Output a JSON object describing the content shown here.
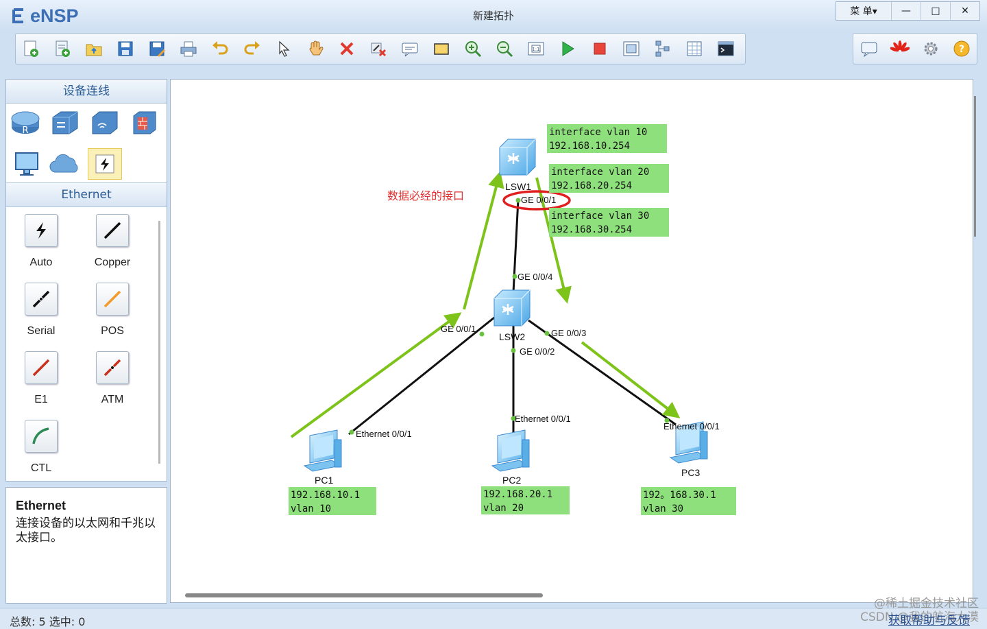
{
  "window": {
    "app_name": "eNSP",
    "title": "新建拓扑",
    "menu_label": "菜 单▾",
    "min_glyph": "—",
    "max_glyph": "□",
    "close_glyph": "✕"
  },
  "toolbar": {
    "icons": [
      "new-topology-icon",
      "new-example-icon",
      "open-icon",
      "save-icon",
      "save-as-icon",
      "print-icon",
      "undo-icon",
      "redo-icon",
      "select-icon",
      "pan-hand-icon",
      "delete-icon",
      "delete-link-icon",
      "text-label-icon",
      "rectangle-icon",
      "zoom-in-icon",
      "zoom-out-icon",
      "fit-to-window-icon",
      "start-device-icon",
      "stop-device-icon",
      "capture-icon",
      "topology-icon",
      "grid-icon",
      "cli-icon"
    ],
    "right_icons": [
      "chat-icon",
      "huawei-icon",
      "settings-icon",
      "help-icon"
    ]
  },
  "left_panel": {
    "devices_header": "设备连线",
    "devices": [
      "router-icon",
      "switch-icon",
      "wireless-icon",
      "firewall-icon",
      "pc-icon",
      "cloud-icon",
      "connection-icon"
    ],
    "ethernet_header": "Ethernet",
    "cables": [
      {
        "label": "Auto",
        "icon": "auto-cable-icon",
        "color": "#111111"
      },
      {
        "label": "Copper",
        "icon": "copper-cable-icon",
        "color": "#111111"
      },
      {
        "label": "Serial",
        "icon": "serial-cable-icon",
        "color": "#111111"
      },
      {
        "label": "POS",
        "icon": "pos-cable-icon",
        "color": "#f39a2b"
      },
      {
        "label": "E1",
        "icon": "e1-cable-icon",
        "color": "#c8321e"
      },
      {
        "label": "ATM",
        "icon": "atm-cable-icon",
        "color": "#c8321e"
      },
      {
        "label": "CTL",
        "icon": "ctl-cable-icon",
        "color": "#2e8b57"
      }
    ]
  },
  "info_panel": {
    "title": "Ethernet",
    "description": "连接设备的以太网和千兆以太接口。"
  },
  "topology": {
    "annotation": "数据必经的接口",
    "devices": {
      "lsw1": "LSW1",
      "lsw2": "LSW2",
      "pc1": "PC1",
      "pc2": "PC2",
      "pc3": "PC3"
    },
    "ports": {
      "lsw1_ge001": "GE 0/0/1",
      "lsw2_ge004": "GE 0/0/4",
      "lsw2_ge001": "GE 0/0/1",
      "lsw2_ge002": "GE 0/0/2",
      "lsw2_ge003": "GE 0/0/3",
      "pc1_eth": "Ethernet 0/0/1",
      "pc2_eth": "Ethernet 0/0/1",
      "pc3_eth": "Ethernet 0/0/1"
    },
    "notes": {
      "vlan10_line1": "interface vlan 10",
      "vlan10_line2": "192.168.10.254",
      "vlan20_line1": "interface vlan 20",
      "vlan20_line2": "192.168.20.254",
      "vlan30_line1": "interface vlan 30",
      "vlan30_line2": "192.168.30.254",
      "pc1_line1": "192.168.10.1",
      "pc1_line2": "vlan 10",
      "pc2_line1": "192.168.20.1",
      "pc2_line2": "vlan 20",
      "pc3_line1": "192。168.30.1",
      "pc3_line2": "vlan 30"
    },
    "colors": {
      "note_bg": "#8ee07c",
      "arrow": "#7dc31a",
      "link": "#111111",
      "port_dot": "#6ac240",
      "highlight": "#e02020",
      "annotation_text": "#e03030"
    }
  },
  "status": {
    "text": "总数: 5  选中: 0",
    "watermark": "@稀土掘金技术社区\nCSDN @我的航海大漠",
    "link": "获取帮助与反馈"
  }
}
